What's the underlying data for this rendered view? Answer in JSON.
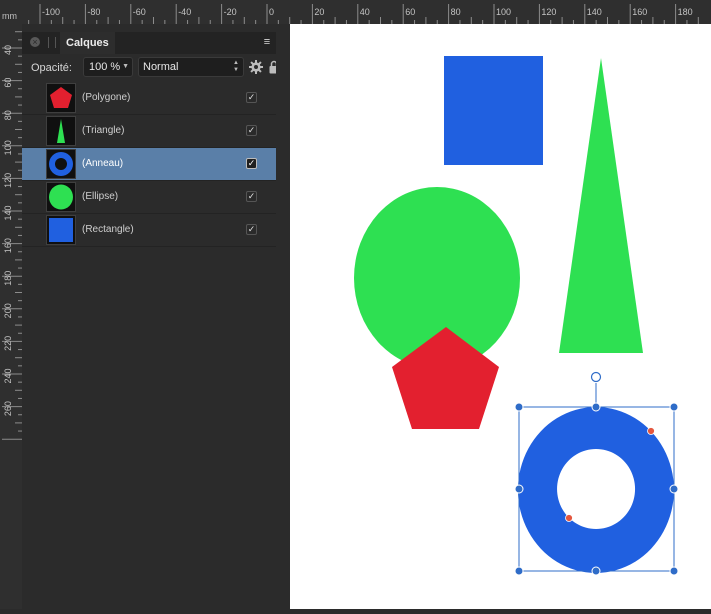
{
  "ruler": {
    "unit": "mm",
    "h_labels": [
      "-100",
      "-80",
      "-60",
      "-40",
      "-20",
      "0",
      "20",
      "40",
      "60",
      "80",
      "100",
      "120",
      "140",
      "160",
      "180"
    ],
    "v_labels": [
      "40",
      "60",
      "80",
      "100",
      "120",
      "140",
      "160",
      "180",
      "200",
      "220",
      "240",
      "260"
    ]
  },
  "panel": {
    "tab_label": "Calques",
    "menu_icon": "hamburger-menu-icon",
    "opacity_label": "Opacité:",
    "opacity_value": "100 %",
    "blend_mode": "Normal",
    "layers": [
      {
        "name": "(Polygone)",
        "shape": "pentagon",
        "color": "#E3202F",
        "visible": true,
        "selected": false
      },
      {
        "name": "(Triangle)",
        "shape": "triangle",
        "color": "#2EE052",
        "visible": true,
        "selected": false
      },
      {
        "name": "(Anneau)",
        "shape": "ring",
        "color": "#2060E0",
        "visible": true,
        "selected": true
      },
      {
        "name": "(Ellipse)",
        "shape": "ellipse",
        "color": "#2EE052",
        "visible": true,
        "selected": false
      },
      {
        "name": "(Rectangle)",
        "shape": "rectangle",
        "color": "#2060E0",
        "visible": true,
        "selected": false
      }
    ]
  },
  "colors": {
    "blue": "#2060E0",
    "green": "#2EE052",
    "red": "#E3202F",
    "selection": "#2F6CC8",
    "handle_red": "#E4573F",
    "selected_row": "#5A7FA8"
  }
}
